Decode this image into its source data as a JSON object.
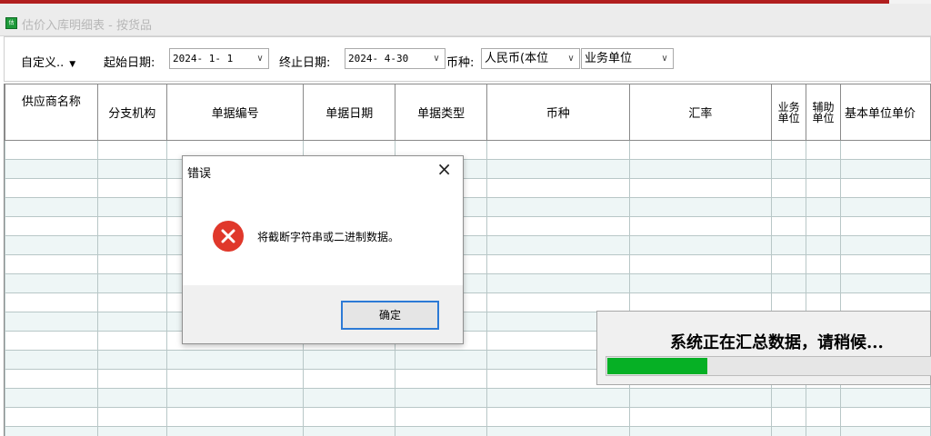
{
  "window": {
    "title": "估价入库明细表 - 按货品",
    "icon": "app-icon"
  },
  "toolbar": {
    "custom_label": "自定义..",
    "start_date_label": "起始日期:",
    "start_date_value": "2024- 1- 1",
    "end_date_label": "终止日期:",
    "end_date_value": "2024- 4-30",
    "currency_label": "币种:",
    "currency_value": "人民币(本位",
    "unit_value": "业务单位"
  },
  "table": {
    "headers": [
      "供应商名称",
      "分支机构",
      "单据编号",
      "单据日期",
      "单据类型",
      "币种",
      "汇率",
      "业务单位",
      "辅助单位",
      "基本单位单价"
    ],
    "header_lines": {
      "biz_unit": [
        "业务",
        "单位"
      ],
      "aux_unit": [
        "辅助",
        "单位"
      ]
    },
    "visible_rows": 16
  },
  "dialog": {
    "title": "错误",
    "message": "将截断字符串或二进制数据。",
    "ok_label": "确定",
    "icon": "error-icon"
  },
  "progress": {
    "message": "系统正在汇总数据，请稍候...",
    "fraction": 0.3,
    "color": "#06b025"
  },
  "colors": {
    "accent": "#2c7ad6",
    "stripe": "#eef6f6",
    "error": "#e0382b"
  }
}
